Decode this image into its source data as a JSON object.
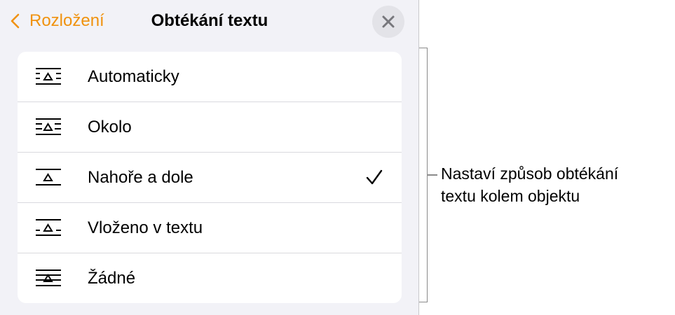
{
  "header": {
    "back_label": "Rozložení",
    "title": "Obtékání textu",
    "back_icon": "chevron-left",
    "close_icon": "x-mark",
    "accent_color": "#f0920e"
  },
  "options": [
    {
      "label": "Automaticky",
      "icon": "wrap-automatic-icon",
      "selected": false
    },
    {
      "label": "Okolo",
      "icon": "wrap-around-icon",
      "selected": false
    },
    {
      "label": "Nahoře a dole",
      "icon": "wrap-above-below-icon",
      "selected": true
    },
    {
      "label": "Vloženo v textu",
      "icon": "wrap-inline-icon",
      "selected": false
    },
    {
      "label": "Žádné",
      "icon": "wrap-none-icon",
      "selected": false
    }
  ],
  "callout": {
    "line1": "Nastaví způsob obtékání",
    "line2": "textu kolem objektu"
  }
}
